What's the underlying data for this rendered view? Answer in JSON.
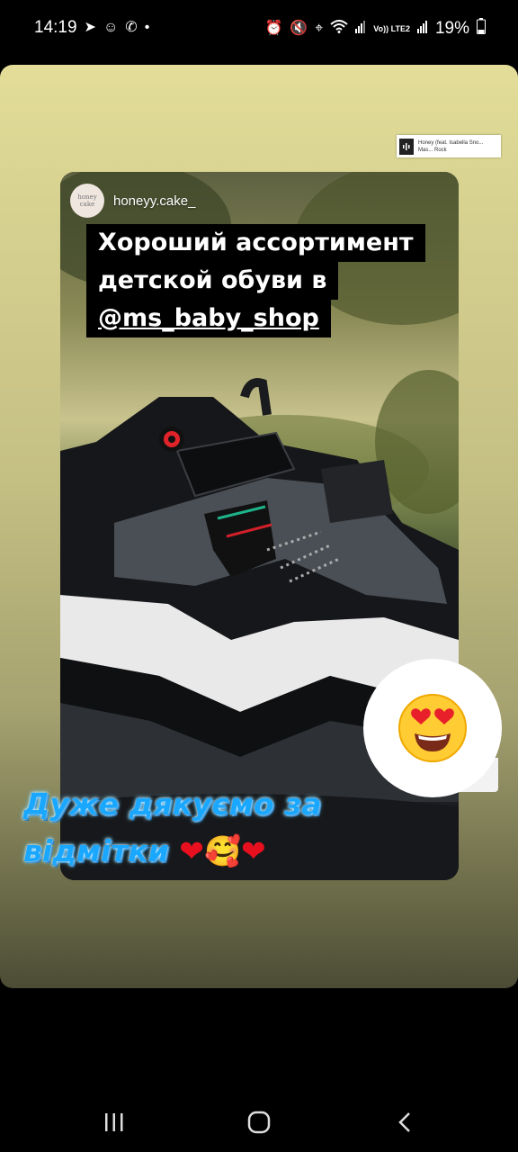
{
  "status_bar": {
    "time": "14:19",
    "battery": "19%",
    "network_label": "Vo)) LTE2"
  },
  "music": {
    "title": "Honey (feat. Isabella Sno...",
    "artist": "Mas... Rock"
  },
  "repost": {
    "avatar_text": "honey cake",
    "username": "honeyy.cake_",
    "caption_line1": "Хороший ассортимент",
    "caption_line2": "детской обуви в",
    "caption_mention": "@ms_baby_shop"
  },
  "reaction": {
    "emoji": "😍"
  },
  "overlay_text": {
    "line1": "Дуже дякуємо за",
    "line2": "відмітки"
  },
  "colors": {
    "story_bg": "#dcd694",
    "thanks_text": "#1aa7ff"
  }
}
